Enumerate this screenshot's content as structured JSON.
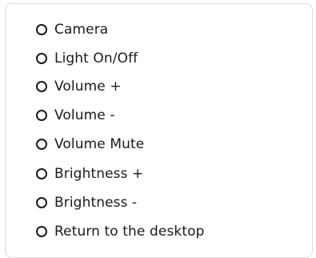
{
  "options": [
    {
      "label": "Camera",
      "selected": false
    },
    {
      "label": "Light On/Off",
      "selected": false
    },
    {
      "label": "Volume +",
      "selected": false
    },
    {
      "label": "Volume -",
      "selected": false
    },
    {
      "label": "Volume Mute",
      "selected": false
    },
    {
      "label": "Brightness +",
      "selected": false
    },
    {
      "label": "Brightness -",
      "selected": false
    },
    {
      "label": "Return to the desktop",
      "selected": false
    }
  ]
}
